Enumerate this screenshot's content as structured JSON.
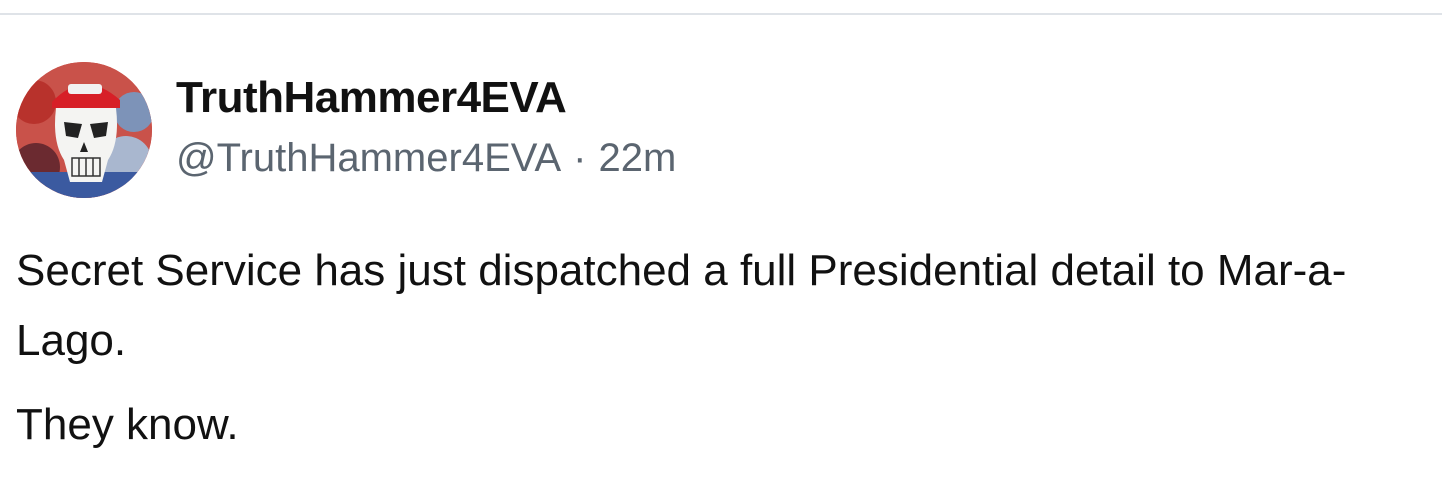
{
  "post": {
    "display_name": "TruthHammer4EVA",
    "handle": "@TruthHammer4EVA",
    "separator": "·",
    "timestamp": "22m",
    "paragraphs": [
      "Secret Service has just dispatched a full Presidential detail to Mar-a-Lago.",
      "They know."
    ],
    "avatar_icon": "punisher-skull-avatar"
  },
  "colors": {
    "name_text": "#111111",
    "meta_text": "#5b6570",
    "divider": "#dfe3e8",
    "background": "#ffffff"
  }
}
